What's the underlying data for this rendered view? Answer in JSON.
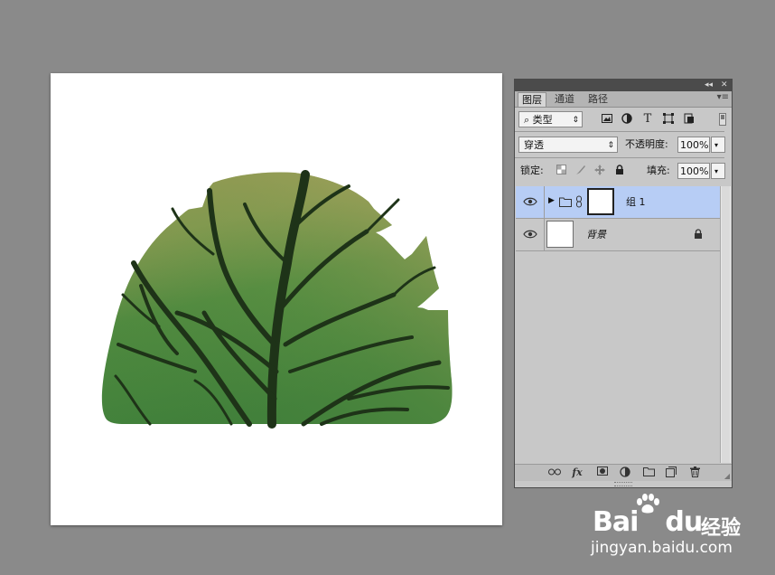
{
  "panel": {
    "titlebar": {
      "collapse_glyph": "◂◂",
      "close_glyph": "✕"
    },
    "tabs": [
      {
        "label": "图层",
        "active": true
      },
      {
        "label": "通道",
        "active": false
      },
      {
        "label": "路径",
        "active": false
      }
    ],
    "menu_glyph": "▾≡",
    "filter": {
      "search_glyph": "⌕",
      "value": "类型",
      "icons": [
        "image-filter-icon",
        "adjustment-filter-icon",
        "type-filter-icon",
        "shape-filter-icon",
        "smart-object-filter-icon"
      ],
      "type_glyph": "T"
    },
    "blend_mode": {
      "value": "穿透"
    },
    "opacity": {
      "label": "不透明度:",
      "value": "100%"
    },
    "lock": {
      "label": "锁定:"
    },
    "fill": {
      "label": "填充:",
      "value": "100%"
    },
    "layers": [
      {
        "name": "组 1",
        "type": "group",
        "selected": true,
        "visible": true
      },
      {
        "name": "背景",
        "type": "background",
        "selected": false,
        "visible": true,
        "locked": true
      }
    ],
    "bottom_icons": [
      "link-layers-icon",
      "fx-icon",
      "add-mask-icon",
      "adjustment-layer-icon",
      "new-group-icon",
      "new-layer-icon",
      "delete-layer-icon"
    ],
    "fx_label": "fx"
  },
  "watermark": {
    "brand": "Bai",
    "brand2": "du",
    "suffix": "经验",
    "url": "jingyan.baidu.com"
  },
  "colors": {
    "selected_row": "#b7cdf5",
    "canvas_bg": "#ffffff",
    "workspace_bg": "#8a8a8a"
  }
}
